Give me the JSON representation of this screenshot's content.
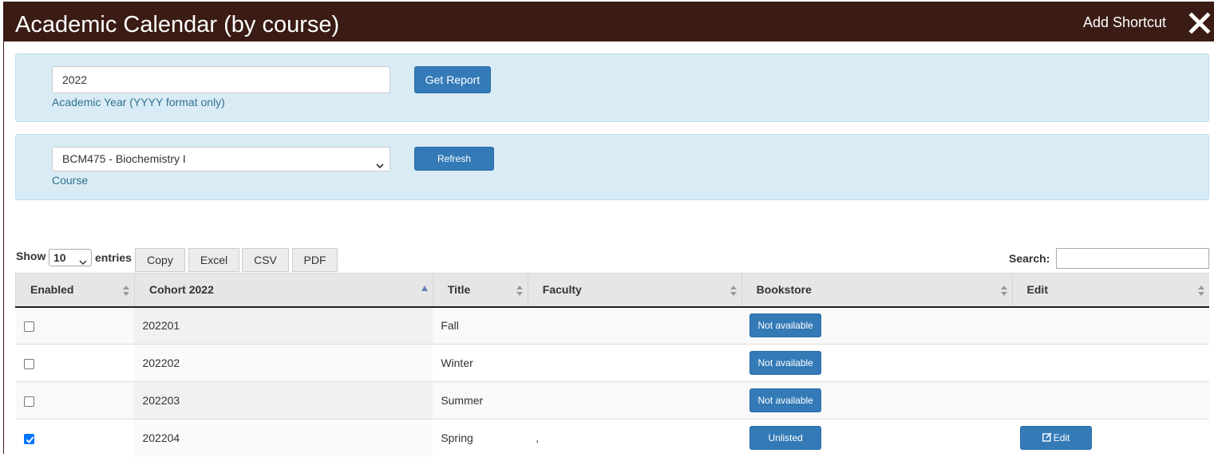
{
  "window": {
    "title": "Academic Calendar (by course)",
    "add_shortcut": "Add Shortcut",
    "close_icon": "close-icon"
  },
  "report_panel": {
    "year_value": "2022",
    "year_help": "Academic Year (YYYY format only)",
    "get_report_label": "Get Report"
  },
  "course_panel": {
    "course_selected": "BCM475 - Biochemistry I",
    "course_help": "Course",
    "refresh_label": "Refresh"
  },
  "table_controls": {
    "show_label": "Show",
    "page_length": "10",
    "entries_label": "entries",
    "buttons": [
      "Copy",
      "Excel",
      "CSV",
      "PDF"
    ],
    "search_label": "Search:",
    "search_value": ""
  },
  "table": {
    "columns": [
      "Enabled",
      "Cohort 2022",
      "Title",
      "Faculty",
      "Bookstore",
      "Edit"
    ],
    "sorted_column": "Cohort 2022",
    "rows": [
      {
        "enabled": false,
        "cohort": "202201",
        "title": "Fall",
        "faculty": "",
        "bookstore": "Not available",
        "edit": ""
      },
      {
        "enabled": false,
        "cohort": "202202",
        "title": "Winter",
        "faculty": "",
        "bookstore": "Not available",
        "edit": ""
      },
      {
        "enabled": false,
        "cohort": "202203",
        "title": "Summer",
        "faculty": "",
        "bookstore": "Not available",
        "edit": ""
      },
      {
        "enabled": true,
        "cohort": "202204",
        "title": "Spring",
        "faculty": ",",
        "bookstore": "Unlisted",
        "edit": "Edit"
      }
    ]
  },
  "colors": {
    "titlebar": "#3a1c14",
    "panel_bg": "#d9ecf5",
    "help_text": "#31708f",
    "primary_button": "#337ab7",
    "checkbox_checked": "#0075ff"
  }
}
